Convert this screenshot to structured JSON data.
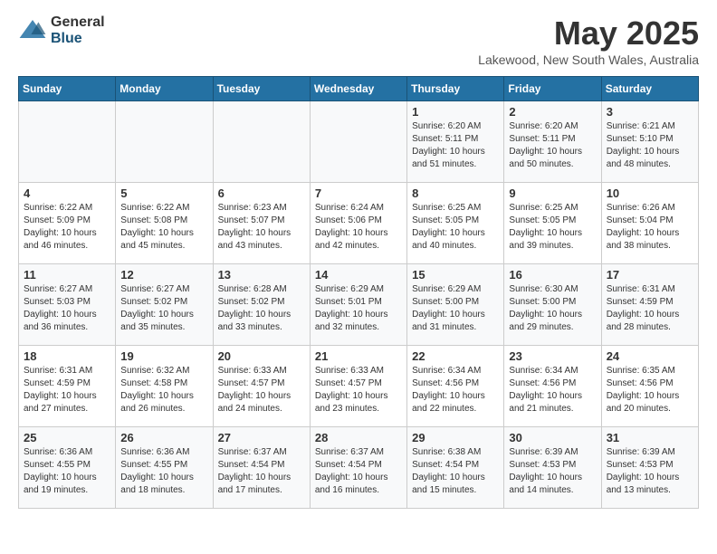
{
  "logo": {
    "general": "General",
    "blue": "Blue"
  },
  "title": {
    "month_year": "May 2025",
    "location": "Lakewood, New South Wales, Australia"
  },
  "days_of_week": [
    "Sunday",
    "Monday",
    "Tuesday",
    "Wednesday",
    "Thursday",
    "Friday",
    "Saturday"
  ],
  "weeks": [
    [
      {
        "day": "",
        "info": ""
      },
      {
        "day": "",
        "info": ""
      },
      {
        "day": "",
        "info": ""
      },
      {
        "day": "",
        "info": ""
      },
      {
        "day": "1",
        "info": "Sunrise: 6:20 AM\nSunset: 5:11 PM\nDaylight: 10 hours\nand 51 minutes."
      },
      {
        "day": "2",
        "info": "Sunrise: 6:20 AM\nSunset: 5:11 PM\nDaylight: 10 hours\nand 50 minutes."
      },
      {
        "day": "3",
        "info": "Sunrise: 6:21 AM\nSunset: 5:10 PM\nDaylight: 10 hours\nand 48 minutes."
      }
    ],
    [
      {
        "day": "4",
        "info": "Sunrise: 6:22 AM\nSunset: 5:09 PM\nDaylight: 10 hours\nand 46 minutes."
      },
      {
        "day": "5",
        "info": "Sunrise: 6:22 AM\nSunset: 5:08 PM\nDaylight: 10 hours\nand 45 minutes."
      },
      {
        "day": "6",
        "info": "Sunrise: 6:23 AM\nSunset: 5:07 PM\nDaylight: 10 hours\nand 43 minutes."
      },
      {
        "day": "7",
        "info": "Sunrise: 6:24 AM\nSunset: 5:06 PM\nDaylight: 10 hours\nand 42 minutes."
      },
      {
        "day": "8",
        "info": "Sunrise: 6:25 AM\nSunset: 5:05 PM\nDaylight: 10 hours\nand 40 minutes."
      },
      {
        "day": "9",
        "info": "Sunrise: 6:25 AM\nSunset: 5:05 PM\nDaylight: 10 hours\nand 39 minutes."
      },
      {
        "day": "10",
        "info": "Sunrise: 6:26 AM\nSunset: 5:04 PM\nDaylight: 10 hours\nand 38 minutes."
      }
    ],
    [
      {
        "day": "11",
        "info": "Sunrise: 6:27 AM\nSunset: 5:03 PM\nDaylight: 10 hours\nand 36 minutes."
      },
      {
        "day": "12",
        "info": "Sunrise: 6:27 AM\nSunset: 5:02 PM\nDaylight: 10 hours\nand 35 minutes."
      },
      {
        "day": "13",
        "info": "Sunrise: 6:28 AM\nSunset: 5:02 PM\nDaylight: 10 hours\nand 33 minutes."
      },
      {
        "day": "14",
        "info": "Sunrise: 6:29 AM\nSunset: 5:01 PM\nDaylight: 10 hours\nand 32 minutes."
      },
      {
        "day": "15",
        "info": "Sunrise: 6:29 AM\nSunset: 5:00 PM\nDaylight: 10 hours\nand 31 minutes."
      },
      {
        "day": "16",
        "info": "Sunrise: 6:30 AM\nSunset: 5:00 PM\nDaylight: 10 hours\nand 29 minutes."
      },
      {
        "day": "17",
        "info": "Sunrise: 6:31 AM\nSunset: 4:59 PM\nDaylight: 10 hours\nand 28 minutes."
      }
    ],
    [
      {
        "day": "18",
        "info": "Sunrise: 6:31 AM\nSunset: 4:59 PM\nDaylight: 10 hours\nand 27 minutes."
      },
      {
        "day": "19",
        "info": "Sunrise: 6:32 AM\nSunset: 4:58 PM\nDaylight: 10 hours\nand 26 minutes."
      },
      {
        "day": "20",
        "info": "Sunrise: 6:33 AM\nSunset: 4:57 PM\nDaylight: 10 hours\nand 24 minutes."
      },
      {
        "day": "21",
        "info": "Sunrise: 6:33 AM\nSunset: 4:57 PM\nDaylight: 10 hours\nand 23 minutes."
      },
      {
        "day": "22",
        "info": "Sunrise: 6:34 AM\nSunset: 4:56 PM\nDaylight: 10 hours\nand 22 minutes."
      },
      {
        "day": "23",
        "info": "Sunrise: 6:34 AM\nSunset: 4:56 PM\nDaylight: 10 hours\nand 21 minutes."
      },
      {
        "day": "24",
        "info": "Sunrise: 6:35 AM\nSunset: 4:56 PM\nDaylight: 10 hours\nand 20 minutes."
      }
    ],
    [
      {
        "day": "25",
        "info": "Sunrise: 6:36 AM\nSunset: 4:55 PM\nDaylight: 10 hours\nand 19 minutes."
      },
      {
        "day": "26",
        "info": "Sunrise: 6:36 AM\nSunset: 4:55 PM\nDaylight: 10 hours\nand 18 minutes."
      },
      {
        "day": "27",
        "info": "Sunrise: 6:37 AM\nSunset: 4:54 PM\nDaylight: 10 hours\nand 17 minutes."
      },
      {
        "day": "28",
        "info": "Sunrise: 6:37 AM\nSunset: 4:54 PM\nDaylight: 10 hours\nand 16 minutes."
      },
      {
        "day": "29",
        "info": "Sunrise: 6:38 AM\nSunset: 4:54 PM\nDaylight: 10 hours\nand 15 minutes."
      },
      {
        "day": "30",
        "info": "Sunrise: 6:39 AM\nSunset: 4:53 PM\nDaylight: 10 hours\nand 14 minutes."
      },
      {
        "day": "31",
        "info": "Sunrise: 6:39 AM\nSunset: 4:53 PM\nDaylight: 10 hours\nand 13 minutes."
      }
    ]
  ]
}
